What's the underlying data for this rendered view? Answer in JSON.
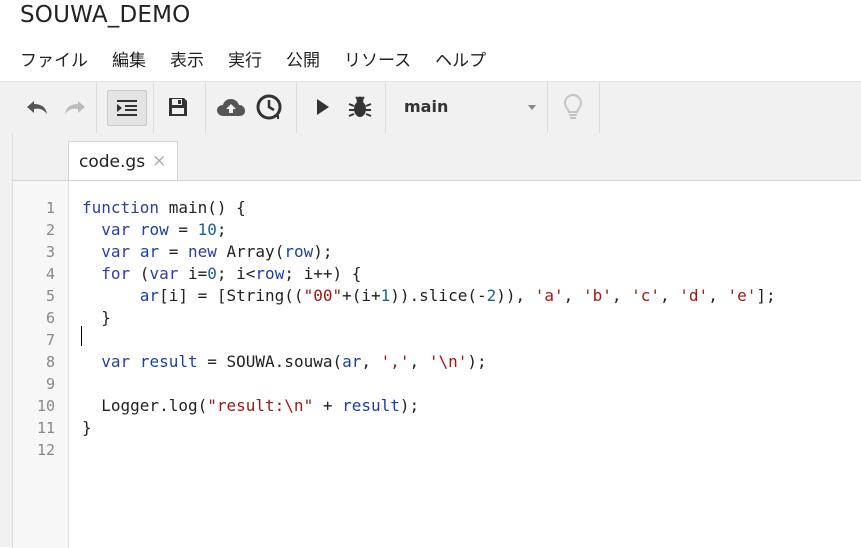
{
  "app": {
    "title": "SOUWA_DEMO"
  },
  "menu": [
    "ファイル",
    "編集",
    "表示",
    "実行",
    "公開",
    "リソース",
    "ヘルプ"
  ],
  "toolbar": {
    "function_select": "main",
    "buttons": [
      "undo-icon",
      "redo-icon",
      "indent-icon",
      "save-icon",
      "cloud-upload-icon",
      "clock-icon",
      "run-icon",
      "debug-bug-icon",
      "lightbulb-icon"
    ]
  },
  "tabs": [
    {
      "label": "code.gs",
      "close": "×"
    }
  ],
  "editor": {
    "line_numbers": [
      "1",
      "2",
      "3",
      "4",
      "5",
      "6",
      "7",
      "8",
      "9",
      "10",
      "11",
      "12"
    ],
    "lines": [
      [
        {
          "t": "function",
          "c": "kw"
        },
        {
          "t": " main() {",
          "c": ""
        }
      ],
      [
        {
          "t": "  ",
          "c": ""
        },
        {
          "t": "var",
          "c": "kw"
        },
        {
          "t": " ",
          "c": ""
        },
        {
          "t": "row",
          "c": "var"
        },
        {
          "t": " = ",
          "c": ""
        },
        {
          "t": "10",
          "c": "num"
        },
        {
          "t": ";",
          "c": ""
        }
      ],
      [
        {
          "t": "  ",
          "c": ""
        },
        {
          "t": "var",
          "c": "kw"
        },
        {
          "t": " ",
          "c": ""
        },
        {
          "t": "ar",
          "c": "var"
        },
        {
          "t": " = ",
          "c": ""
        },
        {
          "t": "new",
          "c": "kw"
        },
        {
          "t": " Array(",
          "c": ""
        },
        {
          "t": "row",
          "c": "var"
        },
        {
          "t": ");",
          "c": ""
        }
      ],
      [
        {
          "t": "  ",
          "c": ""
        },
        {
          "t": "for",
          "c": "kw"
        },
        {
          "t": " (",
          "c": ""
        },
        {
          "t": "var",
          "c": "kw"
        },
        {
          "t": " i=",
          "c": ""
        },
        {
          "t": "0",
          "c": "num"
        },
        {
          "t": "; i<",
          "c": ""
        },
        {
          "t": "row",
          "c": "var"
        },
        {
          "t": "; i++) {",
          "c": ""
        }
      ],
      [
        {
          "t": "      ",
          "c": ""
        },
        {
          "t": "ar",
          "c": "var"
        },
        {
          "t": "[i] = [String((",
          "c": ""
        },
        {
          "t": "\"00\"",
          "c": "str"
        },
        {
          "t": "+(i+",
          "c": ""
        },
        {
          "t": "1",
          "c": "num"
        },
        {
          "t": ")).slice(-",
          "c": ""
        },
        {
          "t": "2",
          "c": "num"
        },
        {
          "t": ")), ",
          "c": ""
        },
        {
          "t": "'a'",
          "c": "str"
        },
        {
          "t": ", ",
          "c": ""
        },
        {
          "t": "'b'",
          "c": "str"
        },
        {
          "t": ", ",
          "c": ""
        },
        {
          "t": "'c'",
          "c": "str"
        },
        {
          "t": ", ",
          "c": ""
        },
        {
          "t": "'d'",
          "c": "str"
        },
        {
          "t": ", ",
          "c": ""
        },
        {
          "t": "'e'",
          "c": "str"
        },
        {
          "t": "];",
          "c": ""
        }
      ],
      [
        {
          "t": "  }",
          "c": ""
        }
      ],
      [],
      [
        {
          "t": "  ",
          "c": ""
        },
        {
          "t": "var",
          "c": "kw"
        },
        {
          "t": " ",
          "c": ""
        },
        {
          "t": "result",
          "c": "var"
        },
        {
          "t": " = SOUWA.souwa(",
          "c": ""
        },
        {
          "t": "ar",
          "c": "var"
        },
        {
          "t": ", ",
          "c": ""
        },
        {
          "t": "','",
          "c": "str"
        },
        {
          "t": ", ",
          "c": ""
        },
        {
          "t": "'\\n'",
          "c": "str"
        },
        {
          "t": ");",
          "c": ""
        }
      ],
      [],
      [
        {
          "t": "  Logger.log(",
          "c": ""
        },
        {
          "t": "\"result:\\n\"",
          "c": "str"
        },
        {
          "t": " + ",
          "c": ""
        },
        {
          "t": "result",
          "c": "var"
        },
        {
          "t": ");",
          "c": ""
        }
      ],
      [
        {
          "t": "}",
          "c": ""
        }
      ],
      []
    ]
  }
}
